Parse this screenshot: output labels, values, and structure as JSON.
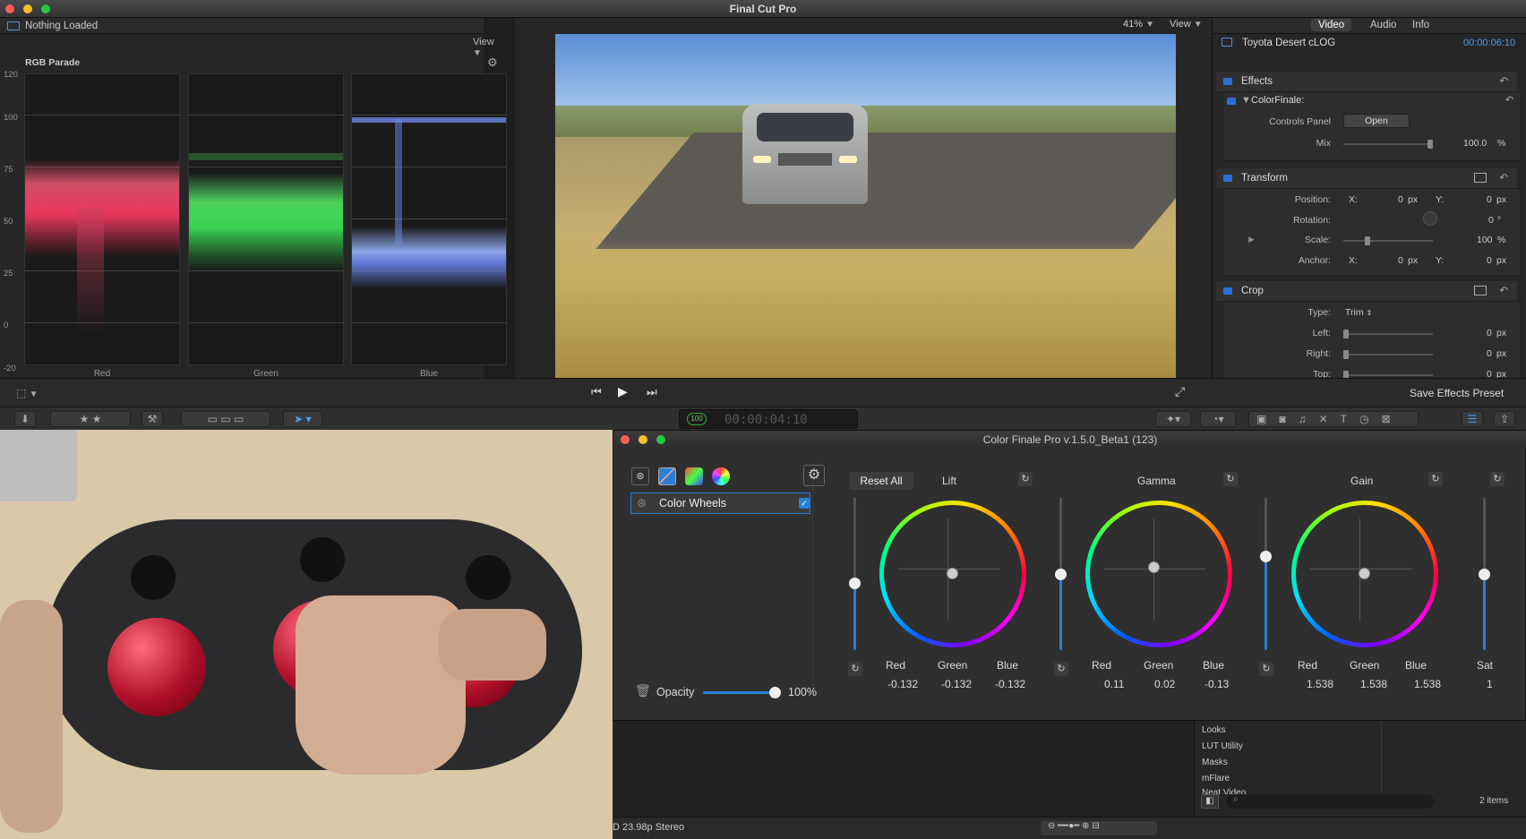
{
  "app": {
    "title": "Final Cut Pro"
  },
  "scopes": {
    "header": "Nothing Loaded",
    "view_label": "View",
    "title": "RGB Parade",
    "ticks": [
      "120",
      "100",
      "75",
      "50",
      "25",
      "0",
      "-20"
    ],
    "channels": [
      "Red",
      "Green",
      "Blue"
    ]
  },
  "viewer": {
    "zoom": "41%",
    "view_label": "View"
  },
  "inspector": {
    "tabs": [
      "Video",
      "Audio",
      "Info"
    ],
    "clip_name": "Toyota Desert cLOG",
    "timecode": "00:00:06:10",
    "effects": {
      "title": "Effects",
      "effect_name": "ColorFinale:",
      "controls_panel_label": "Controls Panel",
      "open_label": "Open",
      "mix_label": "Mix",
      "mix_value": "100.0",
      "mix_unit": "%"
    },
    "transform": {
      "title": "Transform",
      "position_label": "Position:",
      "rotation_label": "Rotation:",
      "scale_label": "Scale:",
      "anchor_label": "Anchor:",
      "x_label": "X:",
      "y_label": "Y:",
      "pos_x": "0",
      "pos_y": "0",
      "rotation": "0",
      "rotation_unit": "°",
      "scale": "100",
      "scale_unit": "%",
      "anchor_x": "0",
      "anchor_y": "0",
      "px": "px"
    },
    "crop": {
      "title": "Crop",
      "type_label": "Type:",
      "type_value": "Trim",
      "left_label": "Left:",
      "right_label": "Right:",
      "top_label": "Top:",
      "left": "0",
      "right": "0",
      "top": "0",
      "px": "px"
    },
    "save_preset": "Save Effects Preset"
  },
  "toolbar": {
    "timecode_display": "00:00:04:10",
    "timecode_big": "4:10",
    "zoom_badge": "100"
  },
  "colorfinale": {
    "title": "Color Finale Pro v.1.5.0_Beta1 (123)",
    "layer_name": "Color Wheels",
    "opacity_label": "Opacity",
    "opacity_value": "100%",
    "reset_all": "Reset All",
    "wheels": [
      {
        "name": "Lift",
        "labels": [
          "Red",
          "Green",
          "Blue"
        ],
        "values": [
          "-0.132",
          "-0.132",
          "-0.132"
        ]
      },
      {
        "name": "Gamma",
        "labels": [
          "Red",
          "Green",
          "Blue"
        ],
        "values": [
          "0.11",
          "0.02",
          "-0.13"
        ]
      },
      {
        "name": "Gain",
        "labels": [
          "Red",
          "Green",
          "Blue"
        ],
        "values": [
          "1.538",
          "1.538",
          "1.538"
        ]
      }
    ],
    "sat_label": "Sat",
    "sat_value": "1",
    "reset_icon": "↻"
  },
  "browser": {
    "items": [
      "Looks",
      "LUT Utility",
      "Masks",
      "mFlare",
      "Neat Video"
    ],
    "count": "2 items",
    "status": "D 23.98p Stereo"
  },
  "colors": {
    "accent": "#2a7fd6"
  }
}
